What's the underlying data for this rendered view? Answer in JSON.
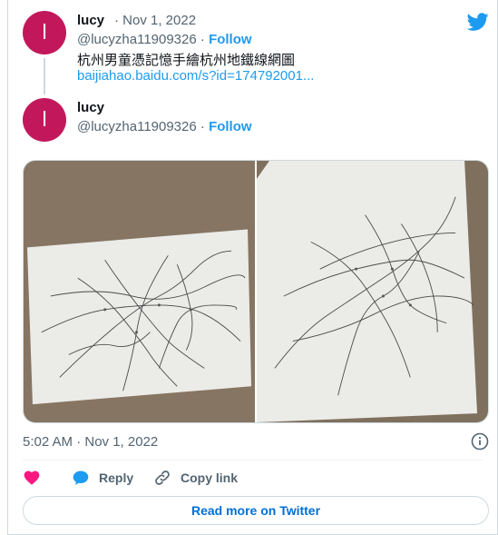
{
  "tweets": [
    {
      "avatar_letter": "l",
      "name": "lucy",
      "date_meta": "· Nov 1, 2022",
      "handle": "@lucyzha11909326",
      "separator": "·",
      "follow_label": "Follow",
      "text": "杭州男童憑記憶手繪杭州地鐵線網圖",
      "link": "baijiahao.baidu.com/s?id=174792001..."
    },
    {
      "avatar_letter": "l",
      "name": "lucy",
      "handle": "@lucyzha11909326",
      "separator": "·",
      "follow_label": "Follow"
    }
  ],
  "media": {
    "photos": [
      {
        "icon": "photo-hand-drawn-metro-map-1"
      },
      {
        "icon": "photo-hand-drawn-metro-map-2"
      }
    ]
  },
  "timestamp": "5:02 AM · Nov 1, 2022",
  "actions": {
    "like_icon": "heart-icon",
    "reply_label": "Reply",
    "copy_label": "Copy link"
  },
  "read_more_label": "Read more on Twitter",
  "colors": {
    "avatar": "#c2185b",
    "accent": "#1d9bf0",
    "like": "#f91880",
    "text": "#0f1419",
    "muted": "#536471"
  }
}
